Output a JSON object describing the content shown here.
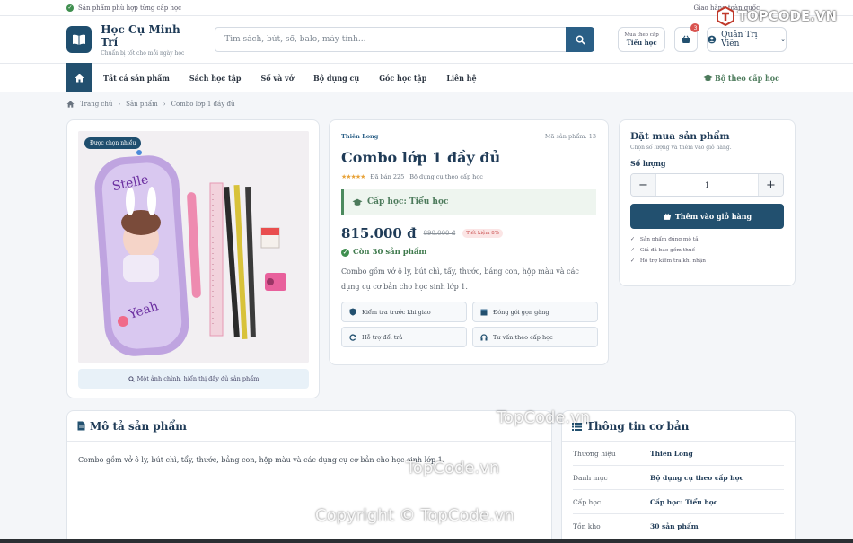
{
  "topbar": {
    "notice": "Sản phẩm phù hợp từng cấp học",
    "right": "Giao hàng toàn quốc"
  },
  "header": {
    "brand_name": "Học Cụ Minh Trí",
    "brand_sub": "Chuẩn bị tốt cho mỗi ngày học",
    "search_placeholder": "Tìm sách, bút, sổ, balo, máy tính...",
    "category_top": "Mua theo cấp",
    "category_bottom": "Tiểu học",
    "cart_count": "3",
    "user": "Quản Trị Viên"
  },
  "nav": {
    "items": [
      "Tất cả sản phẩm",
      "Sách học tập",
      "Sổ và vở",
      "Bộ dụng cụ",
      "Góc học tập",
      "Liên hệ"
    ],
    "right": "Bộ theo cấp học"
  },
  "breadcrumb": [
    "Trang chủ",
    "Sản phẩm",
    "Combo lớp 1 đầy đủ"
  ],
  "gallery": {
    "tag": "Được chọn nhiều",
    "caption": "Một ảnh chính, hiển thị đầy đủ sản phẩm"
  },
  "product": {
    "brand": "Thiên Long",
    "sku": "Mã sản phẩm: 13",
    "title": "Combo lớp 1 đầy đủ",
    "stars": "★★★★★",
    "sold": "Đã bán 225",
    "category": "Bộ dụng cụ theo cấp học",
    "level": "Cấp học: Tiểu học",
    "price": "815.000 đ",
    "old_price": "890.000 đ",
    "discount": "Tiết kiệm 8%",
    "stock": "Còn 30 sản phẩm",
    "description": "Combo gồm vở ô ly, bút chì, tẩy, thước, bảng con, hộp màu và các dụng cụ cơ bản cho học sinh lớp 1.",
    "features": [
      "Kiểm tra trước khi giao",
      "Đóng gói gọn gàng",
      "Hỗ trợ đổi trả",
      "Tư vấn theo cấp học"
    ]
  },
  "buy": {
    "title": "Đặt mua sản phẩm",
    "sub": "Chọn số lượng và thêm vào giỏ hàng.",
    "qty_label": "Số lượng",
    "qty": "1",
    "button": "Thêm vào giỏ hàng",
    "checks": [
      "Sản phẩm đúng mô tả",
      "Giá đã bao gồm thuế",
      "Hỗ trợ kiểm tra khi nhận"
    ]
  },
  "description_section": {
    "title": "Mô tả sản phẩm",
    "body": "Combo gồm vở ô ly, bút chì, tẩy, thước, bảng con, hộp màu và các dụng cụ cơ bản cho học sinh lớp 1."
  },
  "specs": {
    "title": "Thông tin cơ bản",
    "rows": [
      {
        "k": "Thương hiệu",
        "v": "Thiên Long"
      },
      {
        "k": "Danh mục",
        "v": "Bộ dụng cụ theo cấp học"
      },
      {
        "k": "Cấp học",
        "v": "Cấp học: Tiểu học"
      },
      {
        "k": "Tồn kho",
        "v": "30 sản phẩm"
      }
    ]
  },
  "watermarks": {
    "logo_top": "TOPCODE.VN",
    "mid": "TopCode.vn",
    "center": "TopCode.vn",
    "copyright": "Copyright © TopCode.vn"
  },
  "colors": {
    "primary": "#22506f",
    "accent_green": "#4c7a5b",
    "discount_red": "#c84b4b",
    "star": "#e8a43c"
  }
}
